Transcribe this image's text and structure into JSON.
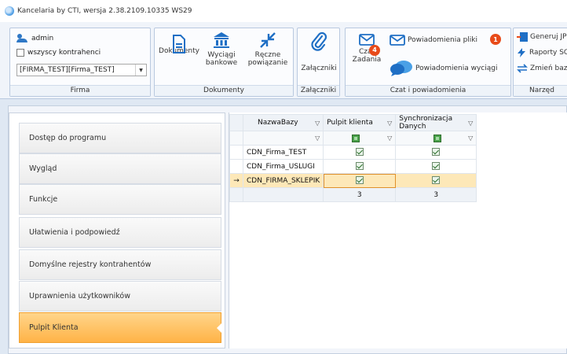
{
  "window": {
    "title": "Kancelaria by CTI, wersja  2.38.2109.10335 WS29"
  },
  "ribbon": {
    "firma": {
      "user": "admin",
      "all_contractors_label": "wszyscy kontrahenci",
      "company_value": "[FIRMA_TEST][Firma_TEST]",
      "group_label": "Firma"
    },
    "dokumenty": {
      "documents_label": "Dokumenty",
      "bank_statements_label_1": "Wyciągi",
      "bank_statements_label_2": "bankowe",
      "manual_link_label_1": "Ręczne",
      "manual_link_label_2": "powiązanie",
      "group_label": "Dokumenty"
    },
    "zalaczniki": {
      "attachments_label": "Załączniki",
      "group_label": "Załączniki"
    },
    "czat": {
      "chat_label_1": "Czat",
      "chat_label_2": "Zadania",
      "chat_badge": "4",
      "file_notifications_label": "Powiadomienia pliki",
      "file_notifications_badge": "1",
      "statement_notifications_label": "Powiadomienia wyciągi",
      "group_label": "Czat i powiadomienia"
    },
    "narzedzia": {
      "item1": "Generuj JP",
      "item2": "Raporty SC",
      "item3": "Zmień baz",
      "group_label": "Narzęd"
    }
  },
  "nav": {
    "items": [
      {
        "label": "Dostęp do programu"
      },
      {
        "label": "Wygląd"
      },
      {
        "label": "Funkcje"
      },
      {
        "label": "Ułatwienia i podpowiedź"
      },
      {
        "label": "Domyślne rejestry kontrahentów"
      },
      {
        "label": "Uprawnienia użytkowników"
      },
      {
        "label": "Pulpit Klienta"
      }
    ],
    "active_index": 6
  },
  "grid": {
    "columns": [
      "NazwaBazy",
      "Pulpit klienta",
      "Synchronizacja Danych"
    ],
    "rows": [
      {
        "name": "CDN_Firma_TEST",
        "pulpit": true,
        "sync": true
      },
      {
        "name": "CDN_Firma_USLUGI",
        "pulpit": true,
        "sync": true
      },
      {
        "name": "CDN_FIRMA_SKLEPIK",
        "pulpit": true,
        "sync": true,
        "selected": true
      }
    ],
    "summary": {
      "pulpit_count": "3",
      "sync_count": "3"
    },
    "row_indicator": "→"
  },
  "colors": {
    "accent_orange": "#ffb347",
    "badge_red": "#e84b1a",
    "brand_blue": "#2f78c6"
  }
}
